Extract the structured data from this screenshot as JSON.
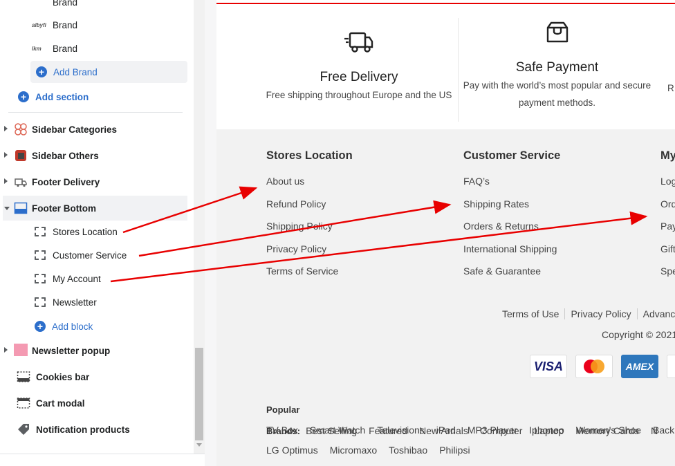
{
  "sidebar": {
    "brands": [
      {
        "logo_text": "",
        "label": "Brand"
      },
      {
        "logo_text": "albyfi",
        "label": "Brand"
      },
      {
        "logo_text": "lkm",
        "label": "Brand"
      }
    ],
    "add_brand": "Add Brand",
    "add_section": "Add section",
    "sections": [
      {
        "label": "Sidebar Categories",
        "expanded": false
      },
      {
        "label": "Sidebar Others",
        "expanded": false
      },
      {
        "label": "Footer Delivery",
        "expanded": false
      },
      {
        "label": "Footer Bottom",
        "expanded": true
      }
    ],
    "blocks": [
      "Stores Location",
      "Customer Service",
      "My Account",
      "Newsletter"
    ],
    "add_block": "Add block",
    "newsletter_popup": "Newsletter popup",
    "cookies_bar": "Cookies bar",
    "cart_modal": "Cart modal",
    "notification_products": "Notification products"
  },
  "preview": {
    "features": [
      {
        "title": "Free Delivery",
        "desc": "Free shipping throughout Europe and the US",
        "icon": "truck-icon"
      },
      {
        "title": "Safe Payment",
        "desc1": "Pay with the world’s most popular and secure",
        "desc2": "payment methods.",
        "icon": "box-icon"
      },
      {
        "partial": "R"
      }
    ],
    "columns": [
      {
        "title": "Stores Location",
        "links": [
          "About us",
          "Refund Policy",
          "Shipping Policy",
          "Privacy Policy",
          "Terms of Service"
        ]
      },
      {
        "title": "Customer Service",
        "links": [
          "FAQ’s",
          "Shipping Rates",
          "Orders & Returns",
          "International Shipping",
          "Safe & Guarantee"
        ]
      },
      {
        "title": "My",
        "links": [
          "Log",
          "Ord",
          "Pay",
          "Gift",
          "Spe"
        ]
      }
    ],
    "bottom_links": [
      "Terms of Use",
      "Privacy Policy",
      "Advance"
    ],
    "copyright": "Copyright © 2021",
    "payments": [
      "VISA",
      "Mastercard",
      "AMEX"
    ],
    "popular_brands_label": "Popular Brands:",
    "popular_brands_line1": [
      "Best Selling",
      "Featured",
      "New Arrials",
      "Computer",
      "Laptop",
      "Memory Cards",
      "N"
    ],
    "popular_brands_line2": [
      "TV Box",
      "Smart Watch",
      "Televisions",
      "iPad",
      "MP3 Player",
      "Iphoneo",
      "Women's Shoe",
      "Backpac"
    ],
    "popular_brands_line3": [
      "LG Optimus",
      "Micromaxo",
      "Toshibao",
      "Philipsi"
    ]
  },
  "colors": {
    "accent_blue": "#2c6ecb",
    "annotation_red": "#e80000"
  }
}
